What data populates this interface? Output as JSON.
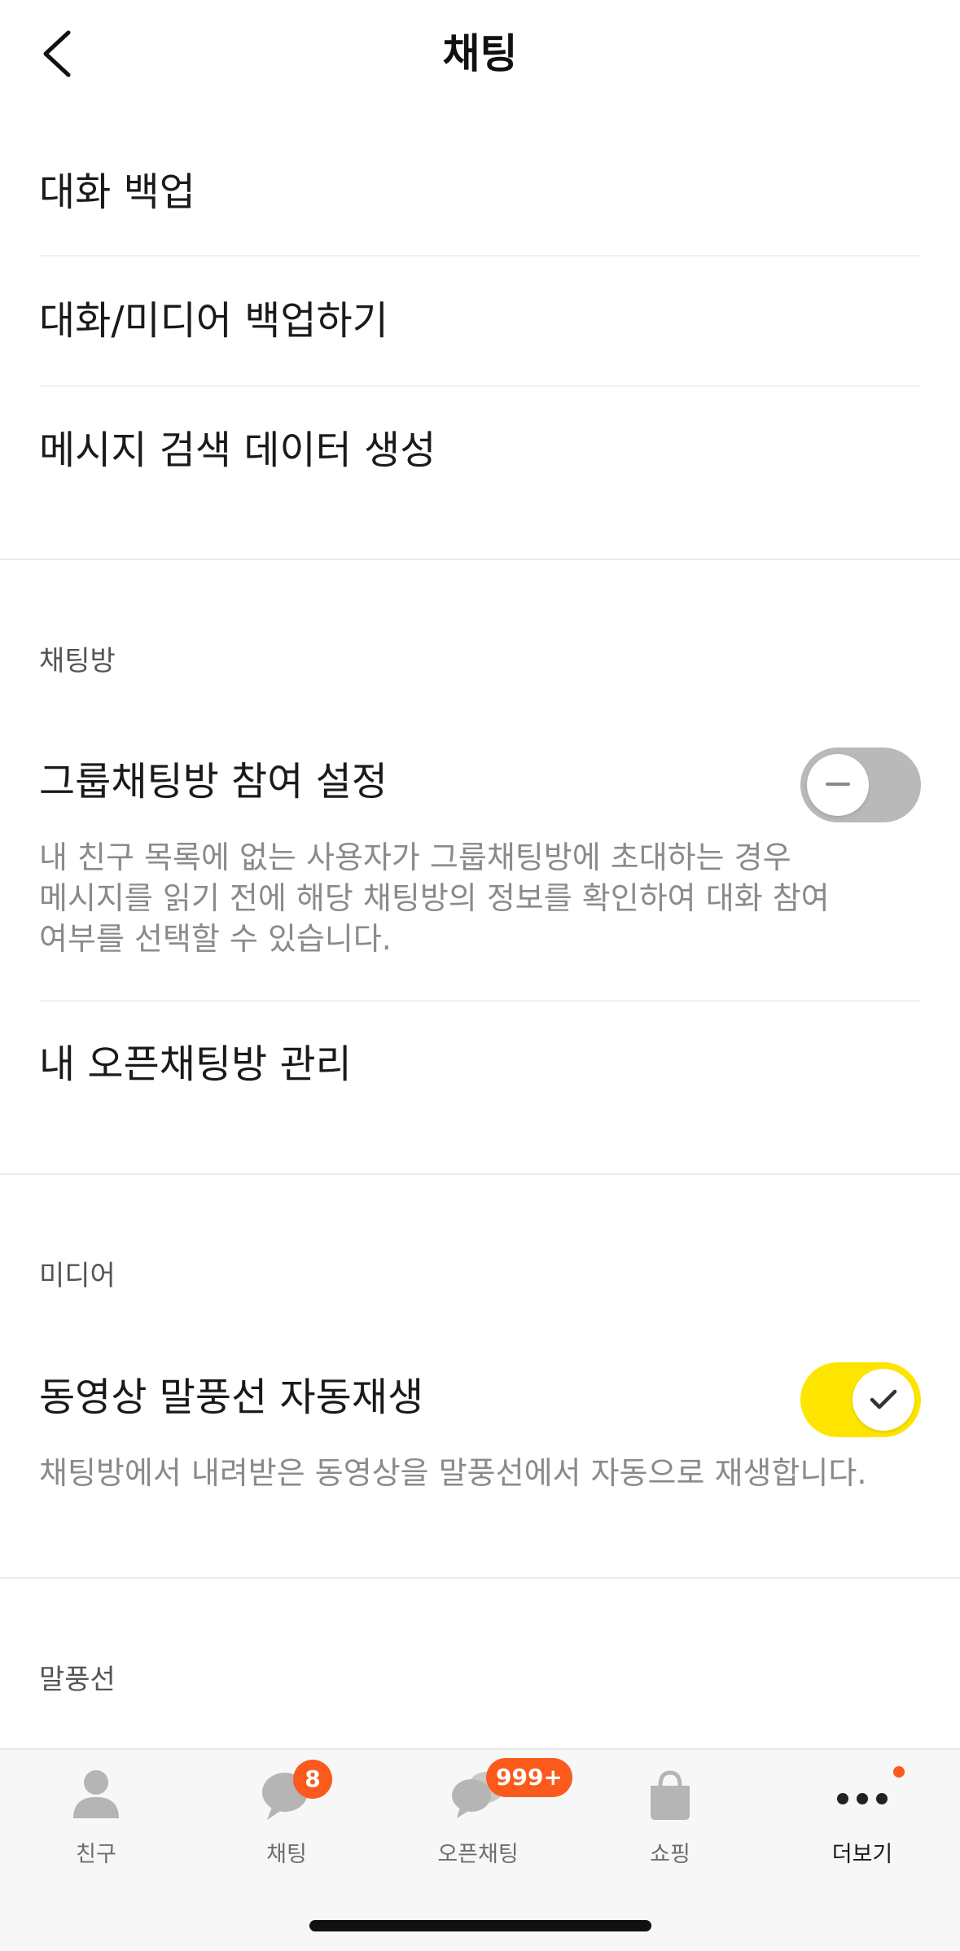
{
  "header": {
    "title": "채팅",
    "back_icon": "chevron-left-icon"
  },
  "backup": {
    "items": [
      {
        "label": "대화 백업"
      },
      {
        "label": "대화/미디어 백업하기"
      },
      {
        "label": "메시지 검색 데이터 생성"
      }
    ]
  },
  "chatroom": {
    "section_title": "채팅방",
    "group_join": {
      "label": "그룹채팅방 참여 설정",
      "toggle_state": "off",
      "desc_lines": [
        "내 친구 목록에 없는 사용자가 그룹채팅방에 초대하는 경우",
        "메시지를 읽기 전에 해당 채팅방의 정보를 확인하여 대화 참여",
        "여부를 선택할 수 있습니다."
      ]
    },
    "open_manage": {
      "label": "내 오픈채팅방 관리"
    }
  },
  "media": {
    "section_title": "미디어",
    "autoplay": {
      "label": "동영상 말풍선 자동재생",
      "toggle_state": "on",
      "desc": "채팅방에서 내려받은 동영상을 말풍선에서 자동으로 재생합니다."
    }
  },
  "bubble": {
    "section_title": "말풍선"
  },
  "tabbar": {
    "tabs": [
      {
        "label": "친구",
        "icon": "person-icon",
        "badge": ""
      },
      {
        "label": "채팅",
        "icon": "chat-bubble-icon",
        "badge": "8"
      },
      {
        "label": "오픈채팅",
        "icon": "open-chat-icon",
        "badge": "999+"
      },
      {
        "label": "쇼핑",
        "icon": "shopping-bag-icon",
        "badge": ""
      },
      {
        "label": "더보기",
        "icon": "more-dots-icon",
        "badge": ""
      }
    ]
  },
  "colors": {
    "accent_yellow": "#fee500",
    "badge_orange": "#fa5a1c",
    "toggle_off": "#b9b9b9"
  }
}
